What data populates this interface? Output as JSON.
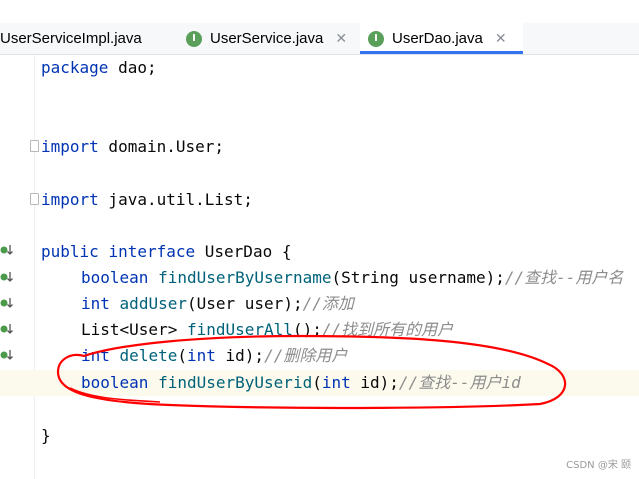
{
  "tabs": [
    {
      "label": "UserServiceImpl.java",
      "icon": "class-file-icon",
      "active": false
    },
    {
      "label": "UserService.java",
      "icon": "interface-file-icon",
      "active": false
    },
    {
      "label": "UserDao.java",
      "icon": "interface-file-icon",
      "active": true
    }
  ],
  "icon_letter": "I",
  "code": {
    "l1_kw": "package",
    "l1_rest": " dao;",
    "l2_kw": "import",
    "l2_rest": " domain.User;",
    "l3_kw": "import",
    "l3_rest": " java.util.List;",
    "l4_kw1": "public",
    "l4_kw2": "interface",
    "l4_rest": " UserDao {",
    "l5_kw": "boolean",
    "l5_fn": "findUserByUsername",
    "l5_rest": "(String username);",
    "l5_cm": "//查找--用户名",
    "l6_kw": "int",
    "l6_fn": "addUser",
    "l6_rest": "(User user);",
    "l6_cm": "//添加",
    "l7_type": "List<User> ",
    "l7_fn": "findUserAll",
    "l7_rest": "();",
    "l7_cm": "//找到所有的用户",
    "l8_kw": "int",
    "l8_fn": "delete",
    "l8_p1": "(",
    "l8_kw2": "int",
    "l8_rest": " id);",
    "l8_cm": "//删除用户",
    "l9_kw": "boolean",
    "l9_fn": "findUserByUserid",
    "l9_p1": "(",
    "l9_kw2": "int",
    "l9_rest": " id);",
    "l9_cm": "//查找--用户id",
    "l10": "}"
  },
  "watermark": "CSDN @宋 颐",
  "colors": {
    "annotation": "#ff0000",
    "keyword": "#0033b3",
    "method": "#00627a",
    "comment": "#8c8c8c"
  }
}
